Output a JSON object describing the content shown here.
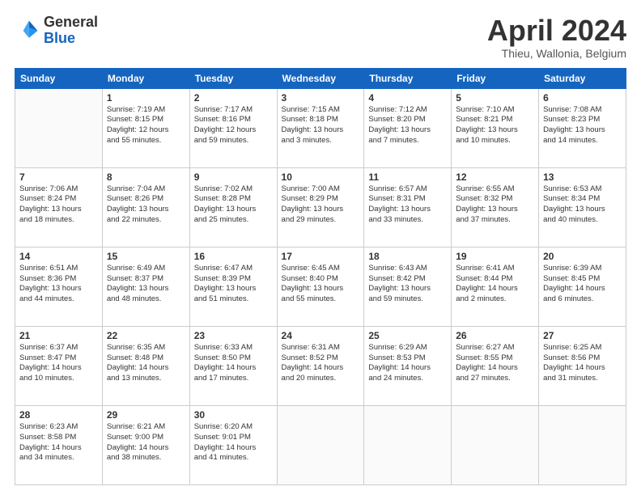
{
  "header": {
    "logo_line1": "General",
    "logo_line2": "Blue",
    "month_title": "April 2024",
    "subtitle": "Thieu, Wallonia, Belgium"
  },
  "weekdays": [
    "Sunday",
    "Monday",
    "Tuesday",
    "Wednesday",
    "Thursday",
    "Friday",
    "Saturday"
  ],
  "weeks": [
    [
      {
        "day": "",
        "info": ""
      },
      {
        "day": "1",
        "info": "Sunrise: 7:19 AM\nSunset: 8:15 PM\nDaylight: 12 hours\nand 55 minutes."
      },
      {
        "day": "2",
        "info": "Sunrise: 7:17 AM\nSunset: 8:16 PM\nDaylight: 12 hours\nand 59 minutes."
      },
      {
        "day": "3",
        "info": "Sunrise: 7:15 AM\nSunset: 8:18 PM\nDaylight: 13 hours\nand 3 minutes."
      },
      {
        "day": "4",
        "info": "Sunrise: 7:12 AM\nSunset: 8:20 PM\nDaylight: 13 hours\nand 7 minutes."
      },
      {
        "day": "5",
        "info": "Sunrise: 7:10 AM\nSunset: 8:21 PM\nDaylight: 13 hours\nand 10 minutes."
      },
      {
        "day": "6",
        "info": "Sunrise: 7:08 AM\nSunset: 8:23 PM\nDaylight: 13 hours\nand 14 minutes."
      }
    ],
    [
      {
        "day": "7",
        "info": "Sunrise: 7:06 AM\nSunset: 8:24 PM\nDaylight: 13 hours\nand 18 minutes."
      },
      {
        "day": "8",
        "info": "Sunrise: 7:04 AM\nSunset: 8:26 PM\nDaylight: 13 hours\nand 22 minutes."
      },
      {
        "day": "9",
        "info": "Sunrise: 7:02 AM\nSunset: 8:28 PM\nDaylight: 13 hours\nand 25 minutes."
      },
      {
        "day": "10",
        "info": "Sunrise: 7:00 AM\nSunset: 8:29 PM\nDaylight: 13 hours\nand 29 minutes."
      },
      {
        "day": "11",
        "info": "Sunrise: 6:57 AM\nSunset: 8:31 PM\nDaylight: 13 hours\nand 33 minutes."
      },
      {
        "day": "12",
        "info": "Sunrise: 6:55 AM\nSunset: 8:32 PM\nDaylight: 13 hours\nand 37 minutes."
      },
      {
        "day": "13",
        "info": "Sunrise: 6:53 AM\nSunset: 8:34 PM\nDaylight: 13 hours\nand 40 minutes."
      }
    ],
    [
      {
        "day": "14",
        "info": "Sunrise: 6:51 AM\nSunset: 8:36 PM\nDaylight: 13 hours\nand 44 minutes."
      },
      {
        "day": "15",
        "info": "Sunrise: 6:49 AM\nSunset: 8:37 PM\nDaylight: 13 hours\nand 48 minutes."
      },
      {
        "day": "16",
        "info": "Sunrise: 6:47 AM\nSunset: 8:39 PM\nDaylight: 13 hours\nand 51 minutes."
      },
      {
        "day": "17",
        "info": "Sunrise: 6:45 AM\nSunset: 8:40 PM\nDaylight: 13 hours\nand 55 minutes."
      },
      {
        "day": "18",
        "info": "Sunrise: 6:43 AM\nSunset: 8:42 PM\nDaylight: 13 hours\nand 59 minutes."
      },
      {
        "day": "19",
        "info": "Sunrise: 6:41 AM\nSunset: 8:44 PM\nDaylight: 14 hours\nand 2 minutes."
      },
      {
        "day": "20",
        "info": "Sunrise: 6:39 AM\nSunset: 8:45 PM\nDaylight: 14 hours\nand 6 minutes."
      }
    ],
    [
      {
        "day": "21",
        "info": "Sunrise: 6:37 AM\nSunset: 8:47 PM\nDaylight: 14 hours\nand 10 minutes."
      },
      {
        "day": "22",
        "info": "Sunrise: 6:35 AM\nSunset: 8:48 PM\nDaylight: 14 hours\nand 13 minutes."
      },
      {
        "day": "23",
        "info": "Sunrise: 6:33 AM\nSunset: 8:50 PM\nDaylight: 14 hours\nand 17 minutes."
      },
      {
        "day": "24",
        "info": "Sunrise: 6:31 AM\nSunset: 8:52 PM\nDaylight: 14 hours\nand 20 minutes."
      },
      {
        "day": "25",
        "info": "Sunrise: 6:29 AM\nSunset: 8:53 PM\nDaylight: 14 hours\nand 24 minutes."
      },
      {
        "day": "26",
        "info": "Sunrise: 6:27 AM\nSunset: 8:55 PM\nDaylight: 14 hours\nand 27 minutes."
      },
      {
        "day": "27",
        "info": "Sunrise: 6:25 AM\nSunset: 8:56 PM\nDaylight: 14 hours\nand 31 minutes."
      }
    ],
    [
      {
        "day": "28",
        "info": "Sunrise: 6:23 AM\nSunset: 8:58 PM\nDaylight: 14 hours\nand 34 minutes."
      },
      {
        "day": "29",
        "info": "Sunrise: 6:21 AM\nSunset: 9:00 PM\nDaylight: 14 hours\nand 38 minutes."
      },
      {
        "day": "30",
        "info": "Sunrise: 6:20 AM\nSunset: 9:01 PM\nDaylight: 14 hours\nand 41 minutes."
      },
      {
        "day": "",
        "info": ""
      },
      {
        "day": "",
        "info": ""
      },
      {
        "day": "",
        "info": ""
      },
      {
        "day": "",
        "info": ""
      }
    ]
  ]
}
